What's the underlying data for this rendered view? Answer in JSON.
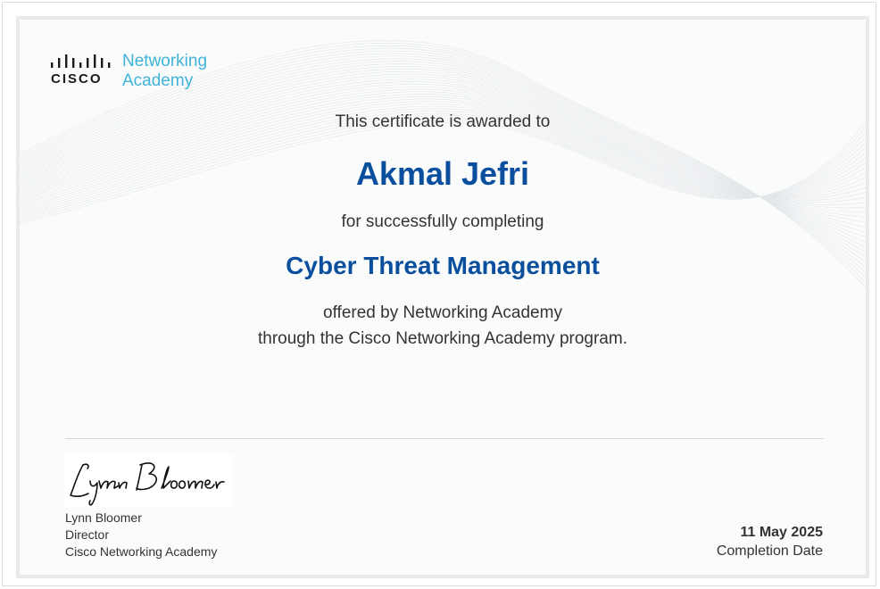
{
  "logo": {
    "brand": "CISCO",
    "program_line1": "Networking",
    "program_line2": "Academy",
    "brand_color": "#3fb3d9"
  },
  "certificate": {
    "intro": "This certificate is awarded to",
    "recipient": "Akmal Jefri",
    "completion_text": "for successfully completing",
    "course": "Cyber Threat Management",
    "offered_by": "offered by Networking Academy",
    "program_text": "through the Cisco Networking Academy program.",
    "accent_color": "#0a4f9e"
  },
  "signatory": {
    "signature": "Lynn Bloomer",
    "name": "Lynn Bloomer",
    "title": "Director",
    "organization": "Cisco Networking Academy"
  },
  "completion": {
    "date": "11 May 2025",
    "label": "Completion Date"
  }
}
